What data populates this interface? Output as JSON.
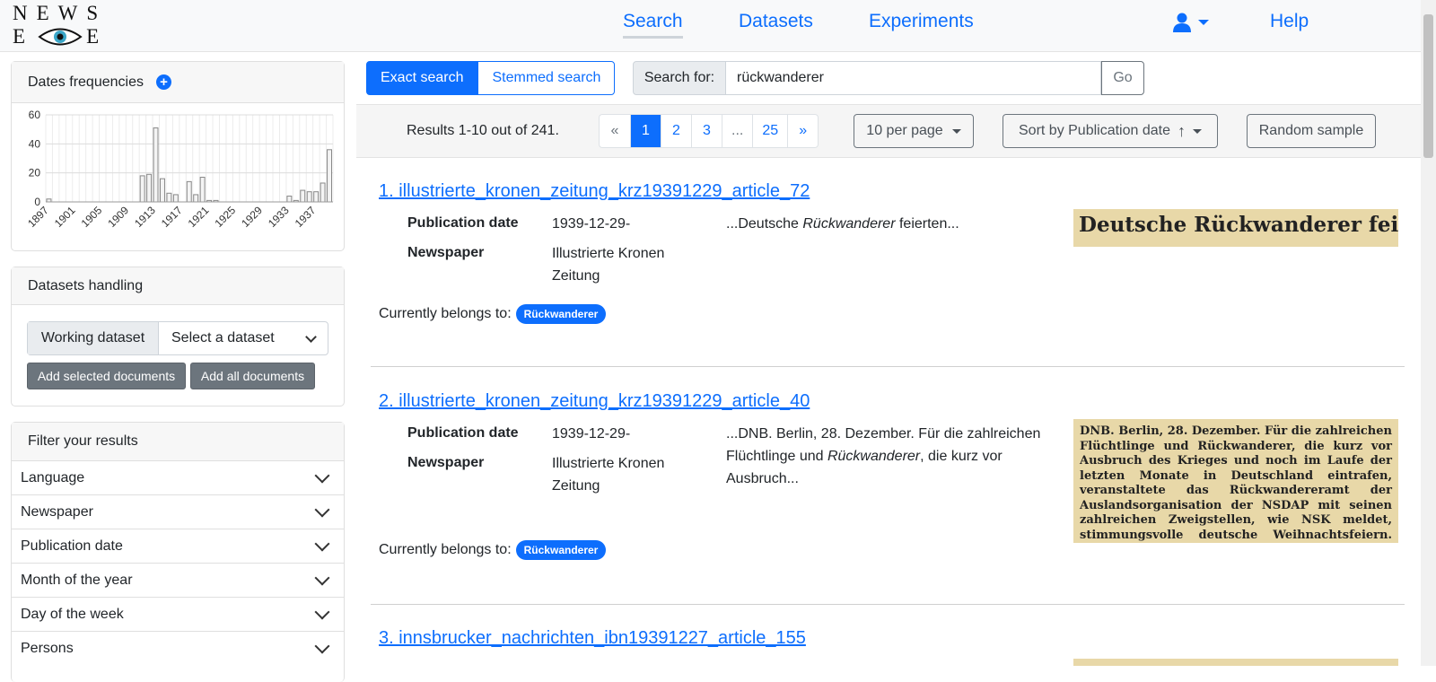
{
  "logo": {
    "line1": "NEWS",
    "line2_left": "E",
    "line2_right": "E"
  },
  "nav": {
    "items": [
      "Search",
      "Datasets",
      "Experiments"
    ],
    "help": "Help"
  },
  "sidebar": {
    "dates_title": "Dates frequencies",
    "datasets_title": "Datasets handling",
    "working_dataset_label": "Working dataset",
    "select_dataset": "Select a dataset",
    "add_selected": "Add selected documents",
    "add_all": "Add all documents",
    "filter_title": "Filter your results",
    "filters": [
      "Language",
      "Newspaper",
      "Publication date",
      "Month of the year",
      "Day of the week",
      "Persons"
    ]
  },
  "chart_data": {
    "type": "bar",
    "title": "",
    "ylim": [
      0,
      60
    ],
    "yticks": [
      "0",
      "20",
      "40",
      "60"
    ],
    "xtick_labels": [
      "1897",
      "1901",
      "1905",
      "1909",
      "1913",
      "1917",
      "1921",
      "1925",
      "1929",
      "1933",
      "1937"
    ],
    "x": [
      1897,
      1898,
      1899,
      1900,
      1901,
      1902,
      1903,
      1904,
      1905,
      1906,
      1907,
      1908,
      1909,
      1910,
      1911,
      1912,
      1913,
      1914,
      1915,
      1916,
      1917,
      1918,
      1919,
      1920,
      1921,
      1922,
      1923,
      1924,
      1925,
      1926,
      1927,
      1928,
      1929,
      1930,
      1931,
      1932,
      1933,
      1934,
      1935,
      1936,
      1937,
      1938,
      1939
    ],
    "values": [
      2,
      0,
      0,
      0,
      0,
      0,
      0,
      0,
      0,
      0,
      0,
      0,
      0,
      0,
      18,
      19,
      51,
      16,
      6,
      5,
      0,
      14,
      5,
      17,
      1,
      1,
      0,
      0,
      0,
      0,
      0,
      0,
      0,
      0,
      0,
      0,
      4,
      1,
      8,
      7,
      7,
      13,
      36
    ],
    "grid": true
  },
  "search": {
    "exact": "Exact search",
    "stemmed": "Stemmed search",
    "search_for": "Search for:",
    "query": "rückwanderer",
    "go": "Go"
  },
  "toolbar": {
    "results_text": "Results 1-10 out of 241.",
    "pages": [
      "«",
      "1",
      "2",
      "3",
      "...",
      "25",
      "»"
    ],
    "per_page": "10 per page",
    "sort": "Sort by Publication date",
    "random": "Random sample"
  },
  "labels": {
    "pub_date": "Publication date",
    "newspaper": "Newspaper",
    "belongs": "Currently belongs to:"
  },
  "results": [
    {
      "title": "1. illustrierte_kronen_zeitung_krz19391229_article_72",
      "date": "1939-12-29-",
      "newspaper": "Illustrierte Kronen Zeitung",
      "snippet_pre": "...Deutsche ",
      "snippet_em": "Rückwanderer",
      "snippet_post": " feierten...",
      "thumb_text": "Deutsche Rückwanderer feierten",
      "badge": "Rückwanderer"
    },
    {
      "title": "2. illustrierte_kronen_zeitung_krz19391229_article_40",
      "date": "1939-12-29-",
      "newspaper": "Illustrierte Kronen Zeitung",
      "snippet_pre": "...DNB. Berlin, 28. Dezember. Für die zahlreichen Flüchtlinge und ",
      "snippet_em": "Rückwanderer",
      "snippet_post": ", die kurz vor Ausbruch...",
      "thumb_text": "DNB. Berlin, 28. Dezember. Für die zahlreichen Flüchtlinge und Rückwanderer, die kurz vor Ausbruch des Krieges und noch im Laufe der letzten Monate in Deutschland eintrafen, veranstaltete das Rückwandereramt der Auslandsorganisation der NSDAP mit seinen zahlreichen Zweigstellen, wie NSK meldet, stimmungsvolle deutsche Weihnachtsfeiern. Für die Volks-",
      "badge": "Rückwanderer"
    },
    {
      "title": "3. innsbrucker_nachrichten_ibn19391227_article_155"
    }
  ]
}
